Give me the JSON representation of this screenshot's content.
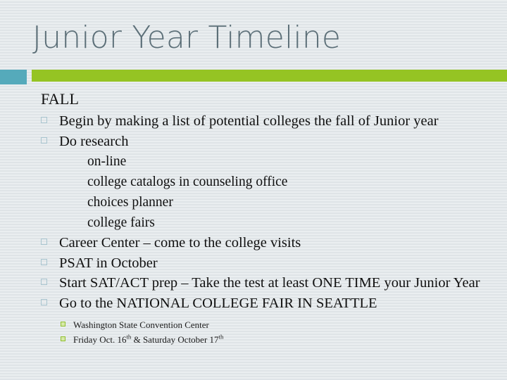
{
  "slide": {
    "title": "Junior Year Timeline",
    "accent": {
      "teal": "#55aabb",
      "green": "#95c423",
      "title_color": "#5c6f78",
      "background": "#e7ebed"
    },
    "section_heading": "FALL",
    "bullets": [
      {
        "level": 1,
        "text": "Begin by making a list of potential colleges the fall of Junior year"
      },
      {
        "level": 1,
        "text": "Do research"
      },
      {
        "level": 2,
        "text": "on-line"
      },
      {
        "level": 2,
        "text": "college catalogs in counseling office"
      },
      {
        "level": 2,
        "text": "choices planner"
      },
      {
        "level": 2,
        "text": "college fairs"
      },
      {
        "level": 1,
        "text": "Career Center – come to the college visits"
      },
      {
        "level": 1,
        "text": "PSAT in October"
      },
      {
        "level": 1,
        "text": "Start SAT/ACT prep – Take the test at least ONE TIME your Junior Year"
      },
      {
        "level": 1,
        "text": "Go to the NATIONAL COLLEGE FAIR IN SEATTLE"
      }
    ],
    "sub_bullets": [
      {
        "level": 3,
        "text": "Washington State Convention Center"
      },
      {
        "level": 3,
        "prefix": "Friday Oct. 16",
        "sup1": "th",
        "middle": " & Saturday October 17",
        "sup2": "th"
      }
    ]
  }
}
